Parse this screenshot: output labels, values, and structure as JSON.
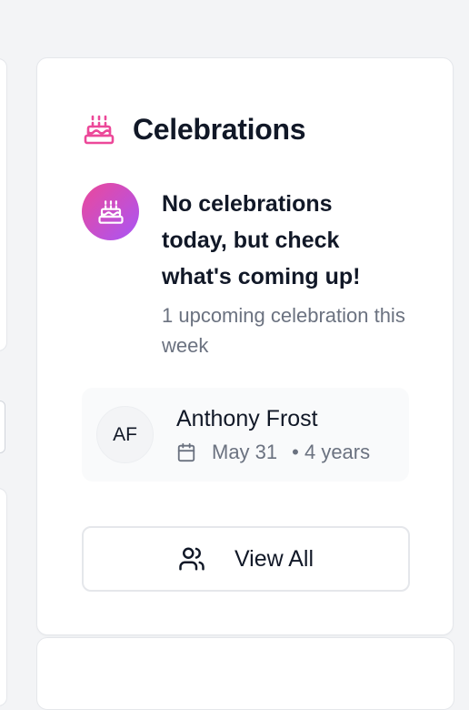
{
  "card": {
    "title": "Celebrations",
    "title_icon": "cake-icon"
  },
  "empty_state": {
    "icon": "cake-icon",
    "title": "No celebrations today, but check what's coming up!",
    "subtitle": "1 upcoming celebration this week"
  },
  "upcoming": [
    {
      "initials": "AF",
      "name": "Anthony Frost",
      "date_icon": "calendar-icon",
      "date": "May 31",
      "detail": "• 4 years"
    }
  ],
  "view_all": {
    "label": "View All",
    "icon": "users-icon"
  },
  "colors": {
    "accent_pink": "#ec4899",
    "accent_purple": "#a855f7",
    "muted_text": "#6b7280"
  }
}
